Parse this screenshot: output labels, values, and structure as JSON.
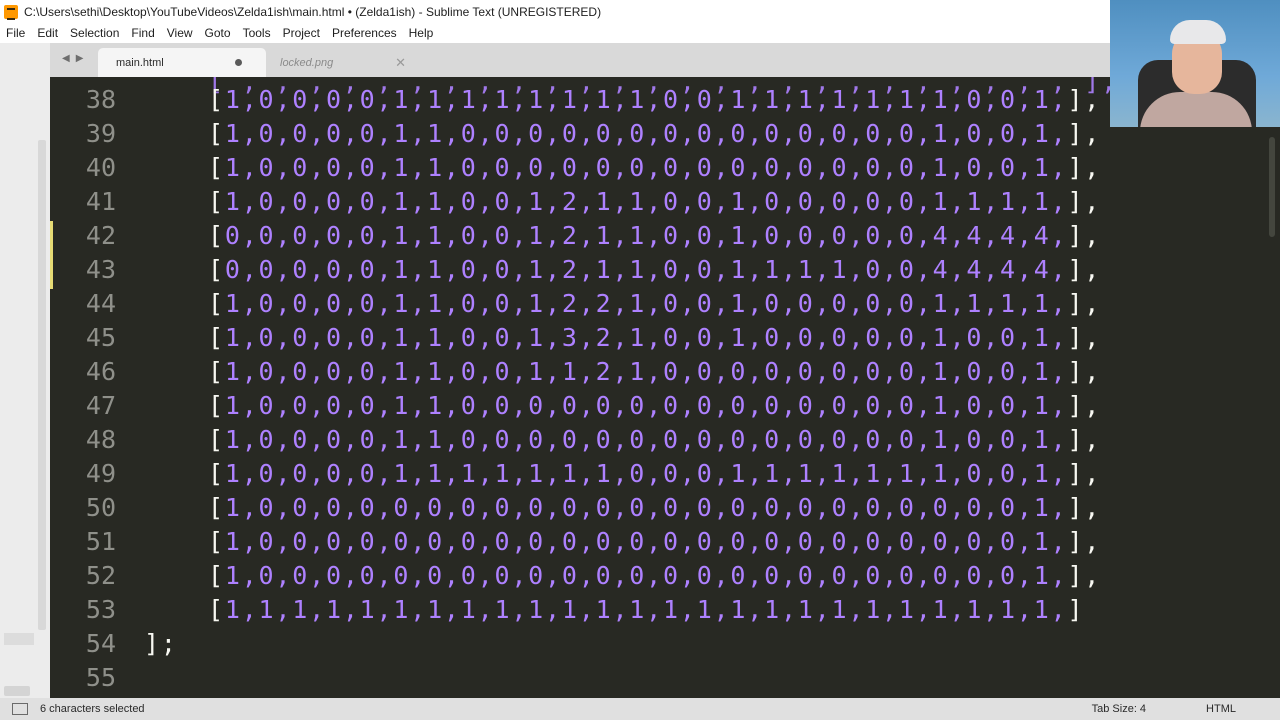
{
  "window": {
    "title": "C:\\Users\\sethi\\Desktop\\YouTubeVideos\\Zelda1ish\\main.html • (Zelda1ish) - Sublime Text (UNREGISTERED)"
  },
  "menu": [
    "File",
    "Edit",
    "Selection",
    "Find",
    "View",
    "Goto",
    "Tools",
    "Project",
    "Preferences",
    "Help"
  ],
  "tabs": [
    {
      "label": "main.html",
      "active": true,
      "dirty": true
    },
    {
      "label": "locked.png",
      "active": false,
      "dirty": false
    }
  ],
  "nav": {
    "back": "◀",
    "forward": "▶"
  },
  "tab_close_glyph": "✕",
  "editor": {
    "partial_top_line": "[ , , , , , , , , , , , , , , , , , , , , , , , , , ],",
    "lines": [
      {
        "number": "38",
        "values": "1,0,0,0,0,1,1,1,1,1,1,1,1,0,0,1,1,1,1,1,1,1,0,0,1,",
        "trail": "],"
      },
      {
        "number": "39",
        "values": "1,0,0,0,0,1,1,0,0,0,0,0,0,0,0,0,0,0,0,0,0,1,0,0,1,",
        "trail": "],"
      },
      {
        "number": "40",
        "values": "1,0,0,0,0,1,1,0,0,0,0,0,0,0,0,0,0,0,0,0,0,1,0,0,1,",
        "trail": "],"
      },
      {
        "number": "41",
        "values": "1,0,0,0,0,1,1,0,0,1,2,1,1,0,0,1,0,0,0,0,0,1,1,1,1,",
        "trail": "],"
      },
      {
        "number": "42",
        "values": "0,0,0,0,0,1,1,0,0,1,2,1,1,0,0,1,0,0,0,0,0,4,4,4,4,",
        "trail": "],"
      },
      {
        "number": "43",
        "values": "0,0,0,0,0,1,1,0,0,1,2,1,1,0,0,1,1,1,1,0,0,4,4,4,4,",
        "trail": "],"
      },
      {
        "number": "44",
        "values": "1,0,0,0,0,1,1,0,0,1,2,2,1,0,0,1,0,0,0,0,0,1,1,1,1,",
        "trail": "],"
      },
      {
        "number": "45",
        "values": "1,0,0,0,0,1,1,0,0,1,3,2,1,0,0,1,0,0,0,0,0,1,0,0,1,",
        "trail": "],"
      },
      {
        "number": "46",
        "values": "1,0,0,0,0,1,1,0,0,1,1,2,1,0,0,0,0,0,0,0,0,1,0,0,1,",
        "trail": "],"
      },
      {
        "number": "47",
        "values": "1,0,0,0,0,1,1,0,0,0,0,0,0,0,0,0,0,0,0,0,0,1,0,0,1,",
        "trail": "],"
      },
      {
        "number": "48",
        "values": "1,0,0,0,0,1,1,0,0,0,0,0,0,0,0,0,0,0,0,0,0,1,0,0,1,",
        "trail": "],"
      },
      {
        "number": "49",
        "values": "1,0,0,0,0,1,1,1,1,1,1,1,0,0,0,1,1,1,1,1,1,1,0,0,1,",
        "trail": "],"
      },
      {
        "number": "50",
        "values": "1,0,0,0,0,0,0,0,0,0,0,0,0,0,0,0,0,0,0,0,0,0,0,0,1,",
        "trail": "],"
      },
      {
        "number": "51",
        "values": "1,0,0,0,0,0,0,0,0,0,0,0,0,0,0,0,0,0,0,0,0,0,0,0,1,",
        "trail": "],"
      },
      {
        "number": "52",
        "values": "1,0,0,0,0,0,0,0,0,0,0,0,0,0,0,0,0,0,0,0,0,0,0,0,1,",
        "trail": "],"
      },
      {
        "number": "53",
        "values": "1,1,1,1,1,1,1,1,1,1,1,1,1,1,1,1,1,1,1,1,1,1,1,1,1,",
        "trail": "]"
      },
      {
        "number": "54",
        "values": "",
        "trail": "];",
        "closing": true
      },
      {
        "number": "55",
        "values": "",
        "trail": ""
      }
    ]
  },
  "status": {
    "selection": "6 characters selected",
    "tab_size": "Tab Size: 4",
    "syntax": "HTML"
  },
  "colors": {
    "editor_bg": "#282923",
    "number_color": "#ae81ff",
    "punct_color": "#f8f8f2",
    "gutter_color": "#8f908a"
  }
}
